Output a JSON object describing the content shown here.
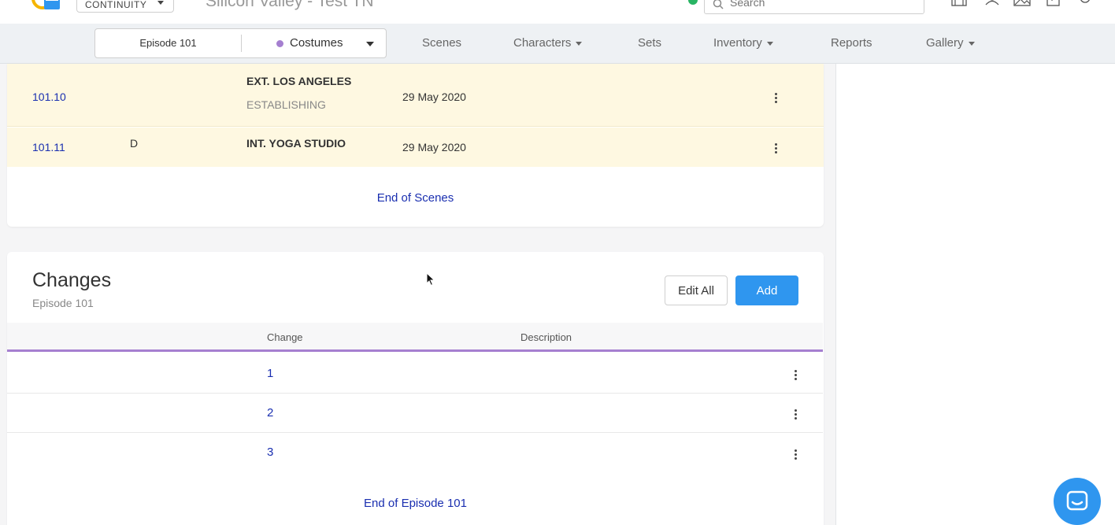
{
  "header": {
    "app_selector": "CONTINUITY",
    "project_title": "Silicon Valley - Test TN",
    "search_placeholder": "Search"
  },
  "context": {
    "episode": "Episode 101",
    "department": "Costumes",
    "department_color": "#a57fd0"
  },
  "nav": {
    "scenes": "Scenes",
    "characters": "Characters",
    "sets": "Sets",
    "inventory": "Inventory",
    "reports": "Reports",
    "gallery": "Gallery"
  },
  "scenes": {
    "rows": [
      {
        "number": "101.10",
        "day_night": "",
        "set": "EXT. LOS ANGELES",
        "subtitle": "ESTABLISHING",
        "date": "29 May 2020"
      },
      {
        "number": "101.11",
        "day_night": "D",
        "set": "INT. YOGA STUDIO",
        "subtitle": "",
        "date": "29 May 2020"
      }
    ],
    "end_label": "End of Scenes"
  },
  "changes": {
    "title": "Changes",
    "subtitle": "Episode 101",
    "edit_all_label": "Edit All",
    "add_label": "Add",
    "columns": {
      "change": "Change",
      "description": "Description"
    },
    "rows": [
      {
        "change": "1",
        "description": ""
      },
      {
        "change": "2",
        "description": ""
      },
      {
        "change": "3",
        "description": ""
      }
    ],
    "end_label": "End of Episode 101"
  },
  "colors": {
    "accent_blue": "#2f96ef",
    "link_blue": "#1a2fb0",
    "highlight_row": "#fef8e1",
    "header_underline": "#a57fd0"
  }
}
